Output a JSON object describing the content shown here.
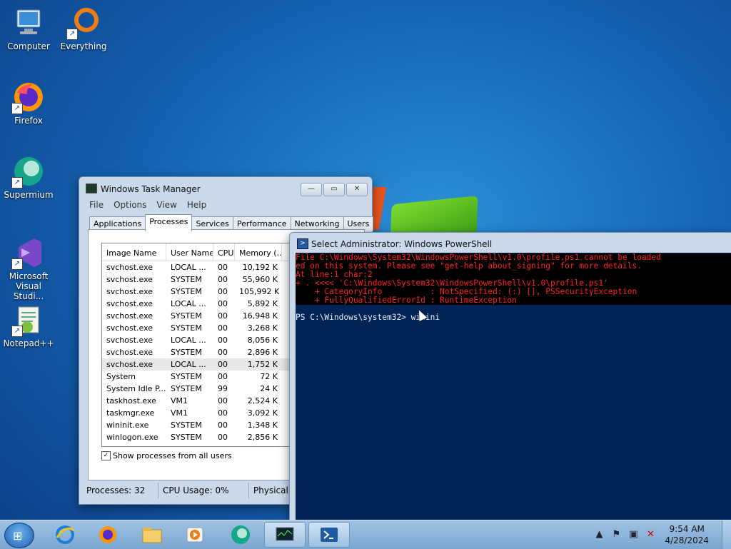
{
  "desktop": {
    "icons": [
      {
        "label": "Computer",
        "icon": "computer-icon"
      },
      {
        "label": "Everything",
        "icon": "everything-icon"
      },
      {
        "label": "Firefox",
        "icon": "firefox-icon"
      },
      {
        "label": "Supermium",
        "icon": "supermium-icon"
      },
      {
        "label": "Microsoft Visual Studi...",
        "icon": "visual-studio-icon"
      },
      {
        "label": "Notepad++",
        "icon": "notepadpp-icon"
      }
    ]
  },
  "task_manager": {
    "title": "Windows Task Manager",
    "menu": [
      "File",
      "Options",
      "View",
      "Help"
    ],
    "tabs": [
      "Applications",
      "Processes",
      "Services",
      "Performance",
      "Networking",
      "Users"
    ],
    "active_tab": "Processes",
    "columns": [
      "Image Name",
      "User Name",
      "CPU",
      "Memory (..."
    ],
    "rows": [
      [
        "svchost.exe",
        "LOCAL ...",
        "00",
        "10,192 K"
      ],
      [
        "svchost.exe",
        "SYSTEM",
        "00",
        "55,960 K"
      ],
      [
        "svchost.exe",
        "SYSTEM",
        "00",
        "105,992 K"
      ],
      [
        "svchost.exe",
        "LOCAL ...",
        "00",
        "5,892 K"
      ],
      [
        "svchost.exe",
        "SYSTEM",
        "00",
        "16,948 K"
      ],
      [
        "svchost.exe",
        "SYSTEM",
        "00",
        "3,268 K"
      ],
      [
        "svchost.exe",
        "LOCAL ...",
        "00",
        "8,056 K"
      ],
      [
        "svchost.exe",
        "SYSTEM",
        "00",
        "2,896 K"
      ],
      [
        "svchost.exe",
        "LOCAL ...",
        "00",
        "1,752 K"
      ],
      [
        "System",
        "SYSTEM",
        "00",
        "72 K"
      ],
      [
        "System Idle P...",
        "SYSTEM",
        "99",
        "24 K"
      ],
      [
        "taskhost.exe",
        "VM1",
        "00",
        "2,524 K"
      ],
      [
        "taskmgr.exe",
        "VM1",
        "00",
        "3,092 K"
      ],
      [
        "wininit.exe",
        "SYSTEM",
        "00",
        "1,348 K"
      ],
      [
        "winlogon.exe",
        "SYSTEM",
        "00",
        "2,856 K"
      ]
    ],
    "show_all_users_label": "Show processes from all users",
    "show_all_users_checked": true,
    "status": {
      "processes": "Processes: 32",
      "cpu": "CPU Usage: 0%",
      "physical": "Physical"
    }
  },
  "powershell": {
    "title": "Select Administrator: Windows PowerShell",
    "error_lines": [
      "File C:\\Windows\\System32\\WindowsPowerShell\\v1.0\\profile.ps1 cannot be loaded",
      "ed on this system. Please see \"get-help about_signing\" for more details.",
      "At line:1 char:2",
      "+ . <<<< 'C:\\Windows\\System32\\WindowsPowerShell\\v1.0\\profile.ps1'",
      "    + CategoryInfo          : NotSpecified: (:) [], PSSecurityException",
      "    + FullyQualifiedErrorId : RuntimeException"
    ],
    "prompt_line": "PS C:\\Windows\\system32> winini"
  },
  "taskbar": {
    "pinned": [
      "ie-icon",
      "firefox-icon",
      "explorer-icon",
      "media-player-icon",
      "supermium-icon",
      "taskmgr-icon",
      "powershell-icon"
    ],
    "clock_time": "9:54 AM",
    "clock_date": "4/28/2024"
  }
}
